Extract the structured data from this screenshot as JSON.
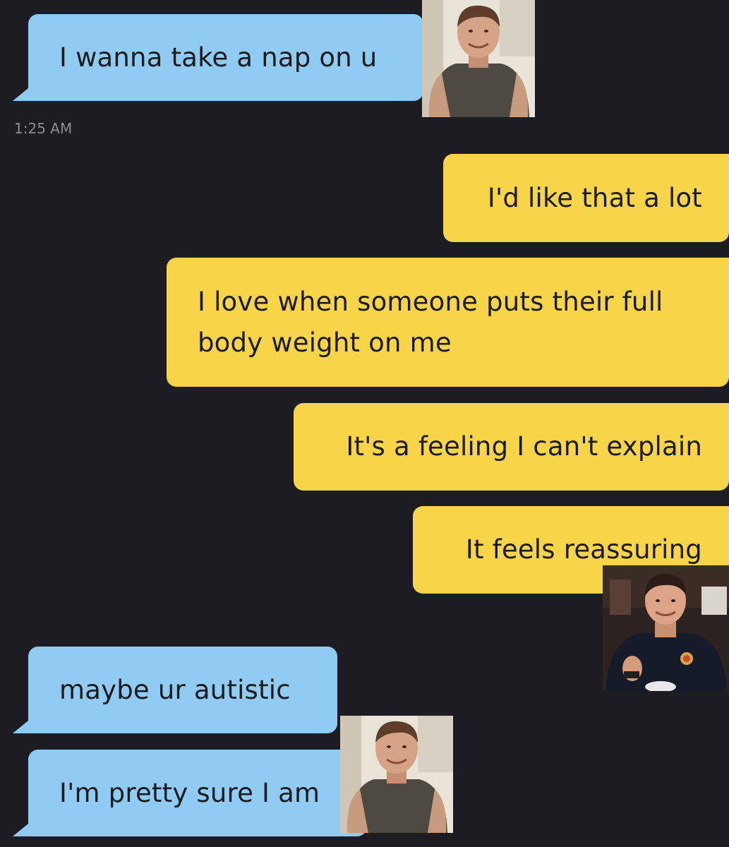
{
  "conversation": {
    "messages": [
      {
        "side": "incoming",
        "text": "I wanna take a nap on u"
      },
      {
        "side": "outgoing",
        "text": "I'd like that a lot"
      },
      {
        "side": "outgoing",
        "line1": "I love when someone puts their full",
        "line2": "body weight on me"
      },
      {
        "side": "outgoing",
        "text": "It's a feeling I can't explain"
      },
      {
        "side": "outgoing",
        "text": "It feels reassuring"
      },
      {
        "side": "incoming",
        "text": "maybe ur autistic"
      },
      {
        "side": "incoming",
        "text": "I'm pretty sure I am"
      }
    ],
    "timestamp": "1:25 AM"
  },
  "colors": {
    "background": "#1d1c22",
    "incoming_bubble": "#8fcbf2",
    "outgoing_bubble": "#f8d449",
    "text": "#1b1b1b",
    "timestamp": "#8c8b92"
  },
  "overlays": [
    {
      "name": "smiling-man-photo",
      "depicts": "smiling man in grey t-shirt"
    },
    {
      "name": "man-eating-cereal-photo",
      "depicts": "smiling man in navy t-shirt holding a spoon"
    },
    {
      "name": "smiling-man-photo-repeat",
      "depicts": "smiling man in grey t-shirt"
    }
  ]
}
